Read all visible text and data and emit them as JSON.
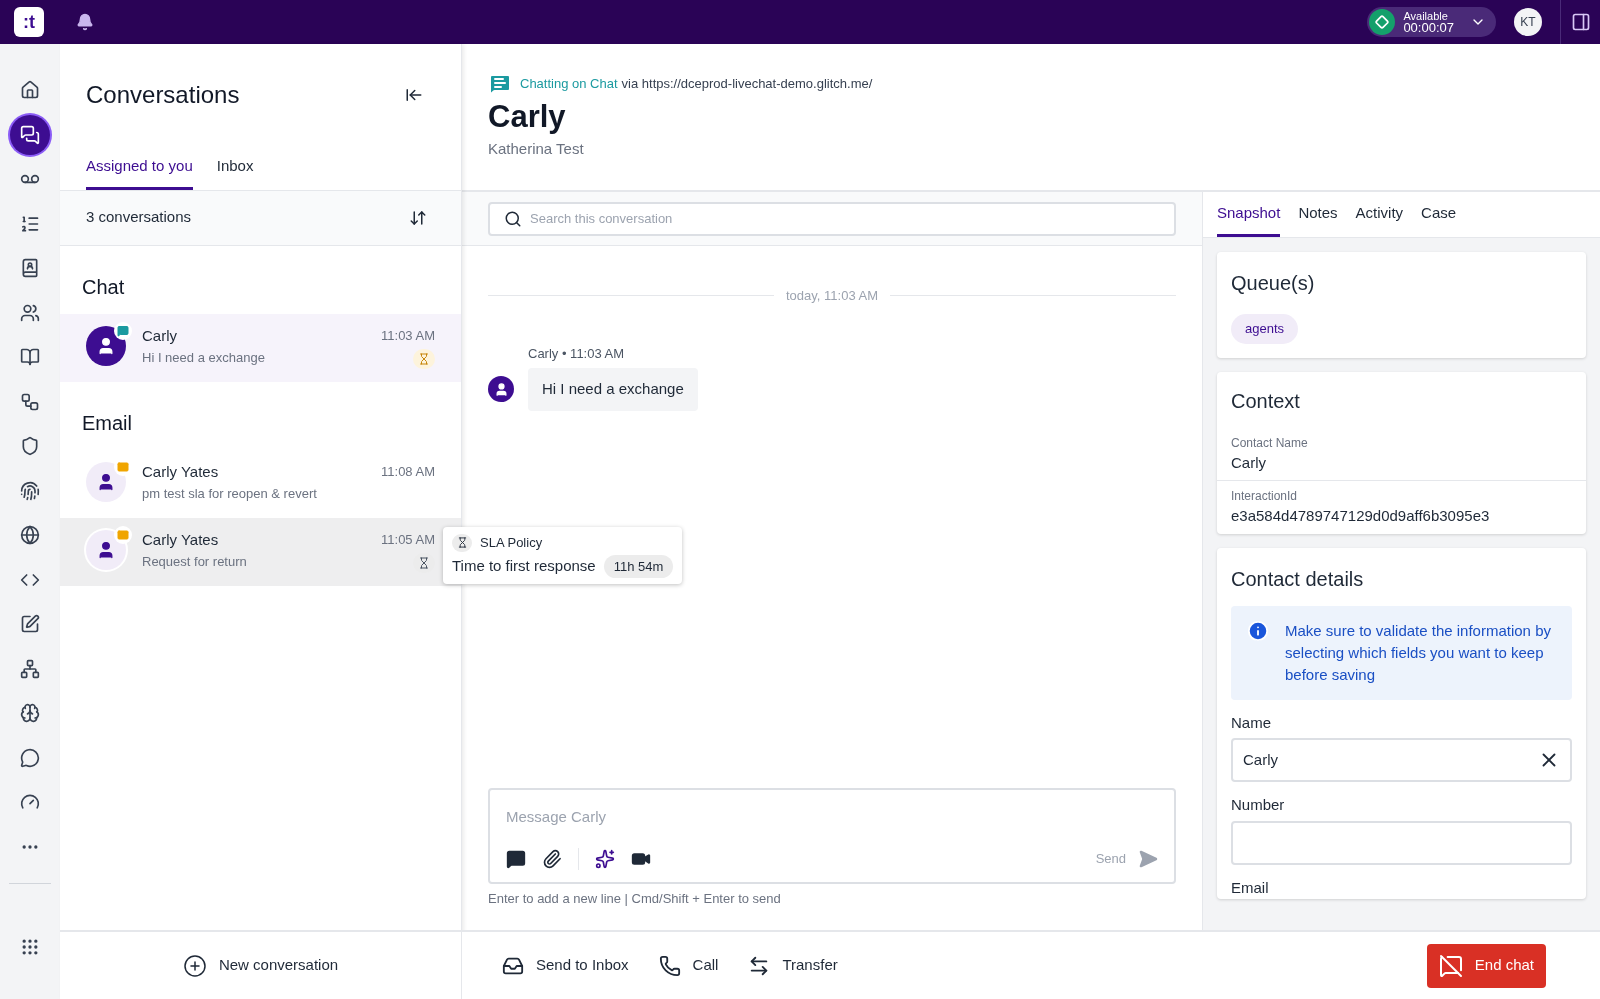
{
  "top_bar": {
    "logo": ":t",
    "status": {
      "label": "Available",
      "timer": "00:00:07"
    },
    "avatar_initials": "KT"
  },
  "nav_rail": {
    "items": [
      {
        "kind": "home",
        "selected": false
      },
      {
        "kind": "conversations",
        "selected": true
      },
      {
        "kind": "voicemail",
        "selected": false
      },
      {
        "kind": "list",
        "selected": false
      },
      {
        "kind": "contacts",
        "selected": false
      },
      {
        "kind": "people",
        "selected": false
      },
      {
        "kind": "book",
        "selected": false
      },
      {
        "kind": "workflow",
        "selected": false
      },
      {
        "kind": "shield",
        "selected": false
      },
      {
        "kind": "fingerprint",
        "selected": false
      },
      {
        "kind": "globe",
        "selected": false
      },
      {
        "kind": "code",
        "selected": false
      },
      {
        "kind": "edit",
        "selected": false
      },
      {
        "kind": "network",
        "selected": false
      },
      {
        "kind": "brain",
        "selected": false
      },
      {
        "kind": "message",
        "selected": false
      },
      {
        "kind": "gauge",
        "selected": false
      },
      {
        "kind": "more",
        "selected": false
      }
    ]
  },
  "conversations": {
    "title": "Conversations",
    "tabs": [
      {
        "label": "Assigned to you",
        "selected": true
      },
      {
        "label": "Inbox",
        "selected": false
      }
    ],
    "count": "3 conversations",
    "groups": [
      {
        "title": "Chat",
        "items": [
          {
            "name": "Carly",
            "preview": "Hi I need a exchange",
            "time": "11:03 AM",
            "kind": "chat",
            "selected": true,
            "hovered": false,
            "sla_badge": {
              "kind": "warning"
            }
          }
        ]
      },
      {
        "title": "Email",
        "items": [
          {
            "name": "Carly Yates",
            "preview": "pm test sla for reopen & revert",
            "time": "11:08 AM",
            "kind": "email",
            "selected": false,
            "hovered": false
          },
          {
            "name": "Carly Yates",
            "preview": "Request for return",
            "time": "11:05 AM",
            "kind": "email",
            "selected": false,
            "hovered": true,
            "sla_badge": {
              "kind": "neutral"
            }
          }
        ]
      }
    ],
    "tooltip": {
      "title": "SLA Policy",
      "label": "Time to first response",
      "value": "11h 54m"
    },
    "new_conversation": "New conversation"
  },
  "header": {
    "channel_label": "Chatting on Chat",
    "via": "via https://dceprod-livechat-demo.glitch.me/",
    "title": "Carly",
    "subtitle": "Katherina Test"
  },
  "chat": {
    "search_placeholder": "Search this conversation",
    "date_divider": "today, 11:03 AM",
    "messages": [
      {
        "meta": "Carly • 11:03 AM",
        "text": "Hi I need a exchange"
      }
    ],
    "composer": {
      "placeholder": "Message Carly",
      "send": "Send",
      "hint": "Enter to add a new line | Cmd/Shift + Enter to send"
    }
  },
  "actions": [
    {
      "kind": "inbox",
      "label": "Send to Inbox"
    },
    {
      "kind": "call",
      "label": "Call"
    },
    {
      "kind": "transfer",
      "label": "Transfer"
    }
  ],
  "end_chat": "End chat",
  "details": {
    "tabs": [
      {
        "label": "Snapshot",
        "selected": true
      },
      {
        "label": "Notes",
        "selected": false
      },
      {
        "label": "Activity",
        "selected": false
      },
      {
        "label": "Case",
        "selected": false
      }
    ],
    "queues": {
      "title": "Queue(s)",
      "tags": [
        "agents"
      ]
    },
    "context": {
      "title": "Context",
      "fields": [
        {
          "label": "Contact Name",
          "value": "Carly"
        },
        {
          "label": "InteractionId",
          "value": "e3a584d4789747129d0d9aff6b3095e3"
        }
      ]
    },
    "contact_details": {
      "title": "Contact details",
      "notice": "Make sure to validate the information by selecting which fields you want to keep before saving",
      "fields": [
        {
          "label": "Name",
          "value": "Carly"
        },
        {
          "label": "Number"
        },
        {
          "label": "Email"
        }
      ]
    }
  }
}
